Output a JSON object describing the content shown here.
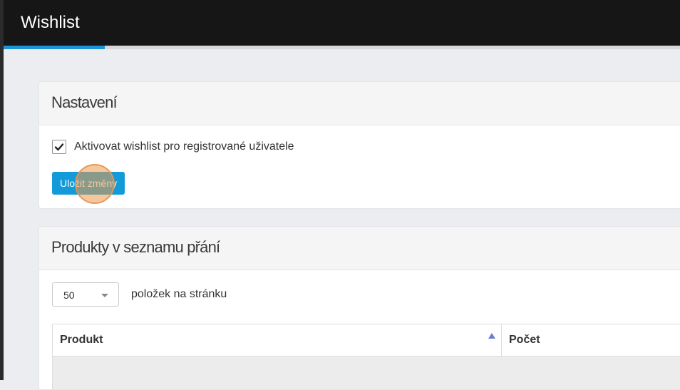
{
  "header": {
    "title": "Wishlist"
  },
  "progress": {
    "percent": 15,
    "color": "#1c94d6"
  },
  "settings": {
    "title": "Nastavení",
    "checkbox": {
      "label": "Aktivovat wishlist pro registrované uživatele",
      "checked": true
    },
    "save_label": "Uložit změny"
  },
  "products": {
    "title": "Produkty v seznamu přání",
    "per_page": {
      "value": "50",
      "label": "položek na stránku"
    },
    "table": {
      "columns": [
        "Produkt",
        "Počet"
      ],
      "sorted_column": "Produkt",
      "sort_direction": "ascending"
    }
  },
  "colors": {
    "accent": "#129ad9",
    "topbar": "#161616",
    "background": "#ecedf0"
  }
}
